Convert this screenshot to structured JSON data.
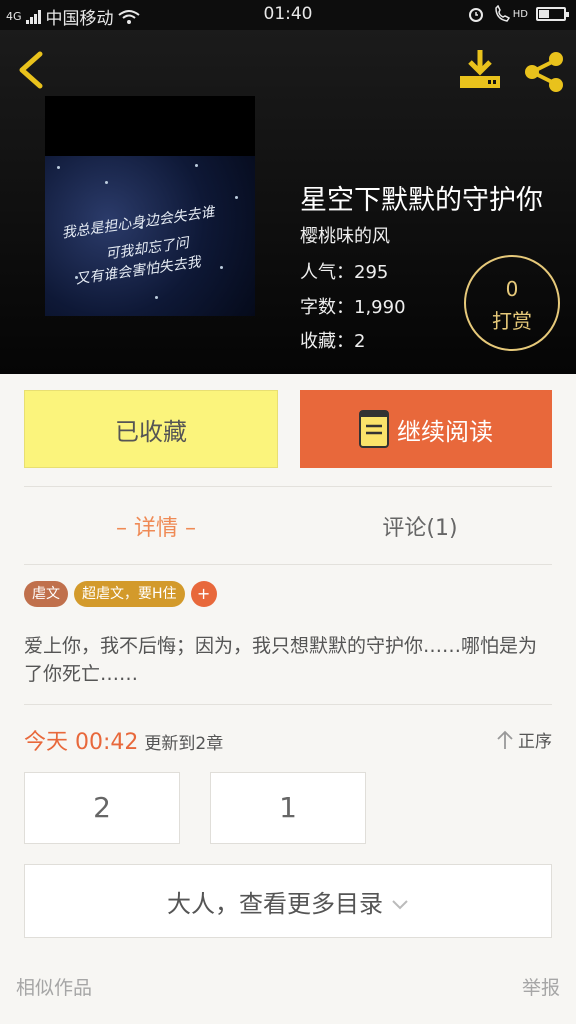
{
  "status_bar": {
    "signal": "4G",
    "carrier": "中国移动",
    "time": "01:40",
    "hd_label": "HD"
  },
  "book": {
    "title": "星空下默默的守护你",
    "author": "樱桃味的风",
    "popularity": "人气：295",
    "word_count": "字数：1,990",
    "favorites": "收藏：2",
    "cover_lines": [
      "我总是担心身边会失去谁",
      "可我却忘了问",
      "又有谁会害怕失去我"
    ]
  },
  "reward": {
    "count": "0",
    "label": "打赏"
  },
  "actions": {
    "favorited_label": "已收藏",
    "continue_label": "继续阅读"
  },
  "tabs": {
    "detail": "– 详情 –",
    "comments": "评论(1)"
  },
  "tags": [
    "虐文",
    "超虐文，要H住",
    "+"
  ],
  "description": "爱上你，我不后悔；因为，我只想默默的守护你……哪怕是为了你死亡……",
  "update": {
    "time": "今天 00:42",
    "text": "更新到2章",
    "sort_label": "正序"
  },
  "chapters": [
    "2",
    "1"
  ],
  "more_toc": "大人，查看更多目录",
  "footer": {
    "similar": "相似作品",
    "report": "举报"
  },
  "colors": {
    "accent_orange": "#e8683b",
    "favorite_yellow": "#fbf47c",
    "header_icon_yellow": "#e9c21c"
  }
}
